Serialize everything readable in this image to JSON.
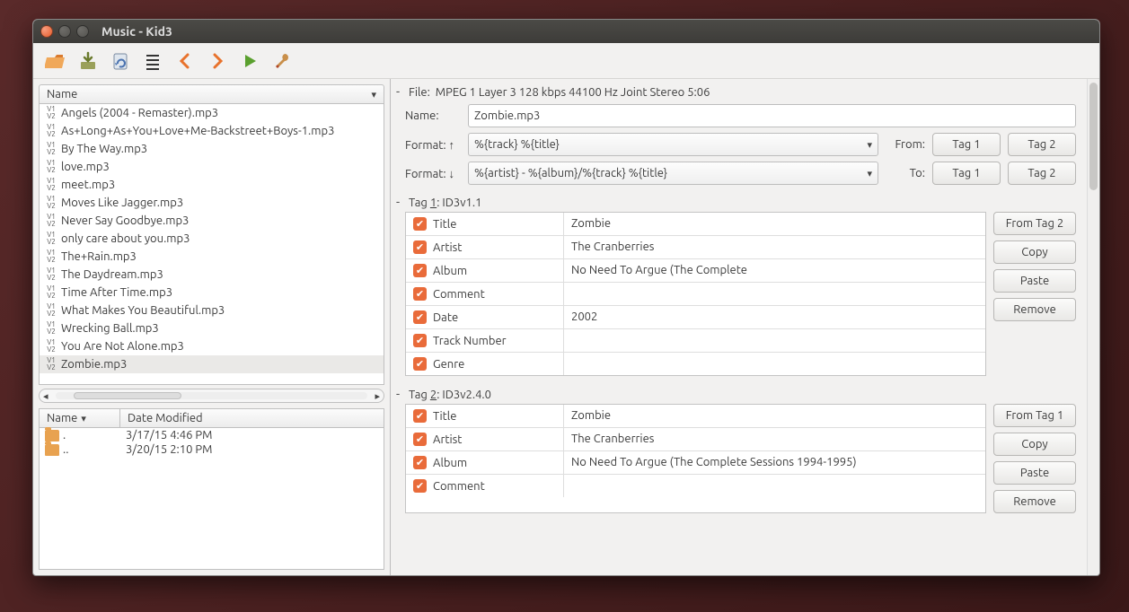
{
  "window": {
    "title": "Music - Kid3"
  },
  "toolbar_icons": [
    "open",
    "save",
    "revert",
    "select-all",
    "prev",
    "next",
    "play",
    "settings"
  ],
  "filelist": {
    "header": "Name",
    "items": [
      {
        "name": "Angels (2004 - Remaster).mp3",
        "selected": false
      },
      {
        "name": "As+Long+As+You+Love+Me-Backstreet+Boys-1.mp3",
        "selected": false
      },
      {
        "name": "By The Way.mp3",
        "selected": false
      },
      {
        "name": "love.mp3",
        "selected": false
      },
      {
        "name": "meet.mp3",
        "selected": false
      },
      {
        "name": "Moves Like Jagger.mp3",
        "selected": false
      },
      {
        "name": "Never Say Goodbye.mp3",
        "selected": false
      },
      {
        "name": "only care about you.mp3",
        "selected": false
      },
      {
        "name": "The+Rain.mp3",
        "selected": false
      },
      {
        "name": "The Daydream.mp3",
        "selected": false
      },
      {
        "name": "Time After Time.mp3",
        "selected": false
      },
      {
        "name": "What Makes You Beautiful.mp3",
        "selected": false
      },
      {
        "name": "Wrecking Ball.mp3",
        "selected": false
      },
      {
        "name": "You Are Not Alone.mp3",
        "selected": false
      },
      {
        "name": "Zombie.mp3",
        "selected": true
      }
    ]
  },
  "dirlist": {
    "cols": {
      "name": "Name",
      "date": "Date Modified"
    },
    "rows": [
      {
        "name": ".",
        "date": "3/17/15 4:46 PM"
      },
      {
        "name": "..",
        "date": "3/20/15 2:10 PM"
      }
    ]
  },
  "file": {
    "section": "File:",
    "info": "MPEG 1 Layer 3 128 kbps 44100 Hz Joint Stereo 5:06",
    "name_label": "Name:",
    "name_value": "Zombie.mp3",
    "format_up_label": "Format: ↑",
    "format_up_value": "%{track} %{title}",
    "format_down_label": "Format: ↓",
    "format_down_value": "%{artist} - %{album}/%{track} %{title}",
    "from_label": "From:",
    "to_label": "To:",
    "tag1_btn": "Tag 1",
    "tag2_btn": "Tag 2"
  },
  "tag1": {
    "header_prefix": "Tag ",
    "header_num": "1",
    "header_rest": ": ID3v1.1",
    "from_btn": "From Tag 2",
    "copy_btn": "Copy",
    "paste_btn": "Paste",
    "remove_btn": "Remove",
    "rows": [
      {
        "field": "Title",
        "value": "Zombie"
      },
      {
        "field": "Artist",
        "value": "The Cranberries"
      },
      {
        "field": "Album",
        "value": "No Need To Argue (The Complete"
      },
      {
        "field": "Comment",
        "value": ""
      },
      {
        "field": "Date",
        "value": "2002"
      },
      {
        "field": "Track Number",
        "value": ""
      },
      {
        "field": "Genre",
        "value": ""
      }
    ]
  },
  "tag2": {
    "header_prefix": "Tag ",
    "header_num": "2",
    "header_rest": ": ID3v2.4.0",
    "from_btn": "From Tag 1",
    "copy_btn": "Copy",
    "paste_btn": "Paste",
    "remove_btn": "Remove",
    "rows": [
      {
        "field": "Title",
        "value": "Zombie"
      },
      {
        "field": "Artist",
        "value": "The Cranberries"
      },
      {
        "field": "Album",
        "value": "No Need To Argue (The Complete Sessions 1994-1995)"
      },
      {
        "field": "Comment",
        "value": ""
      }
    ]
  }
}
